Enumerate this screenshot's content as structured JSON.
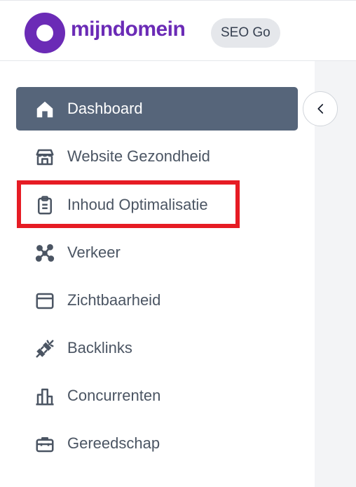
{
  "header": {
    "brand_name": "mijndomein",
    "plan_badge": "SEO Go"
  },
  "sidebar": {
    "items": [
      {
        "label": "Dashboard",
        "icon": "home-icon",
        "active": true
      },
      {
        "label": "Website Gezondheid",
        "icon": "storefront-icon"
      },
      {
        "label": "Inhoud Optimalisatie",
        "icon": "clipboard-icon",
        "highlighted": true
      },
      {
        "label": "Verkeer",
        "icon": "network-nodes-icon"
      },
      {
        "label": "Zichtbaarheid",
        "icon": "browser-window-icon"
      },
      {
        "label": "Backlinks",
        "icon": "plug-icon"
      },
      {
        "label": "Concurrenten",
        "icon": "buildings-icon"
      },
      {
        "label": "Gereedschap",
        "icon": "toolbox-icon"
      }
    ],
    "collapse_icon": "chevron-left-icon"
  },
  "colors": {
    "brand": "#6b2bb6",
    "active_item": "#56657a",
    "highlight": "#e61c24",
    "nav_text": "#4b5563"
  }
}
